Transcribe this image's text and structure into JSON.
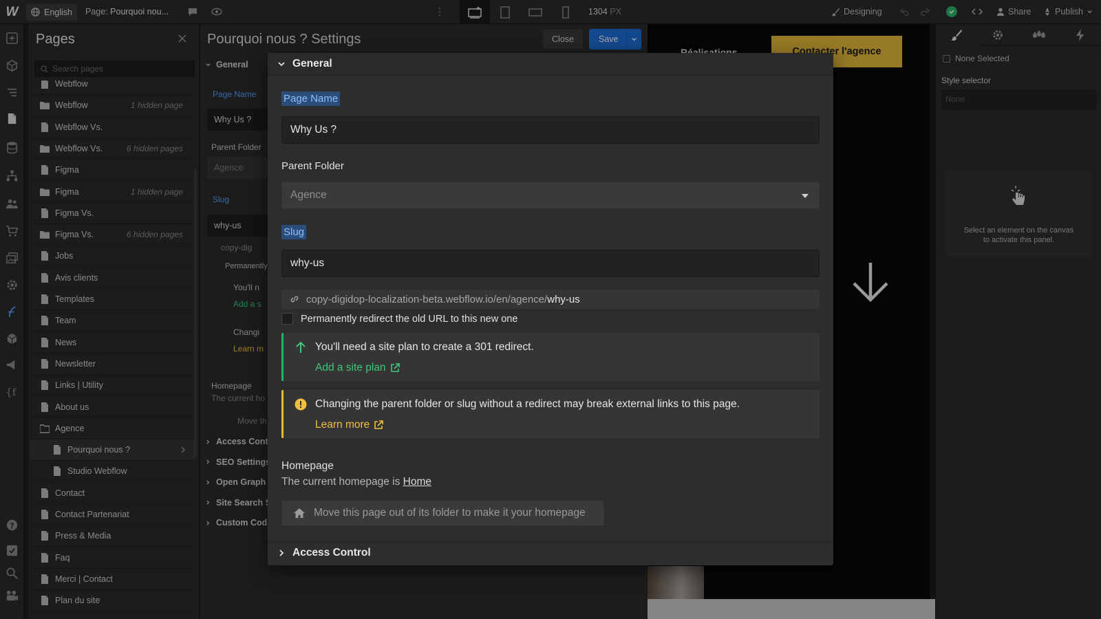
{
  "topbar": {
    "logo": "W",
    "locale": "English",
    "page_prefix": "Page:",
    "page_name": "Pourquoi nou...",
    "width_value": "1304",
    "width_unit": "PX",
    "mode": "Designing",
    "share": "Share",
    "publish": "Publish"
  },
  "pages_panel": {
    "title": "Pages",
    "search_placeholder": "Search pages",
    "items": [
      {
        "label": "Webflow",
        "type": "page",
        "hidden": ""
      },
      {
        "label": "Webflow",
        "type": "folder",
        "hidden": "1 hidden page"
      },
      {
        "label": "Webflow Vs.",
        "type": "page",
        "hidden": ""
      },
      {
        "label": "Webflow Vs.",
        "type": "folder",
        "hidden": "6 hidden pages"
      },
      {
        "label": "Figma",
        "type": "page",
        "hidden": ""
      },
      {
        "label": "Figma",
        "type": "folder",
        "hidden": "1 hidden page"
      },
      {
        "label": "Figma Vs.",
        "type": "page",
        "hidden": ""
      },
      {
        "label": "Figma Vs.",
        "type": "folder",
        "hidden": "6 hidden pages"
      },
      {
        "label": "Jobs",
        "type": "page",
        "hidden": ""
      },
      {
        "label": "Avis clients",
        "type": "page",
        "hidden": ""
      },
      {
        "label": "Templates",
        "type": "page",
        "hidden": ""
      },
      {
        "label": "Team",
        "type": "page",
        "hidden": ""
      },
      {
        "label": "News",
        "type": "page",
        "hidden": ""
      },
      {
        "label": "Newsletter",
        "type": "page",
        "hidden": ""
      },
      {
        "label": "Links | Utility",
        "type": "page",
        "hidden": ""
      },
      {
        "label": "About us",
        "type": "page",
        "hidden": ""
      },
      {
        "label": "Agence",
        "type": "folder-open",
        "hidden": ""
      },
      {
        "label": "Pourquoi nous ?",
        "type": "child-selected",
        "hidden": ""
      },
      {
        "label": "Studio Webflow",
        "type": "child",
        "hidden": ""
      },
      {
        "label": "Contact",
        "type": "page",
        "hidden": ""
      },
      {
        "label": "Contact Partenariat",
        "type": "page",
        "hidden": ""
      },
      {
        "label": "Press & Media",
        "type": "page",
        "hidden": ""
      },
      {
        "label": "Faq",
        "type": "page",
        "hidden": ""
      },
      {
        "label": "Merci | Contact",
        "type": "page",
        "hidden": ""
      },
      {
        "label": "Plan du site",
        "type": "page",
        "hidden": ""
      }
    ]
  },
  "settings": {
    "title": "Pourquoi nous ? Settings",
    "close_label": "Close",
    "save_label": "Save",
    "behind": {
      "general": "General",
      "page_name_label": "Page Name",
      "page_name_value": "Why Us ?",
      "parent_folder_label": "Parent Folder",
      "parent_folder_value": "Agence",
      "slug_label": "Slug",
      "slug_value": "why-us",
      "url_fragment": "copy-dig",
      "redirect_fragment": "Permanently",
      "green_fragment": "You'll n",
      "green_link_fragment": "Add a s",
      "yellow_fragment": "Changi",
      "yellow_link_fragment": "Learn m",
      "homepage_label": "Homepage",
      "homepage_fragment": "The current ho",
      "move_fragment": "Move th",
      "sections": [
        "Access Cont",
        "SEO Settings",
        "Open Graph",
        "Site Search S",
        "Custom Cod"
      ]
    }
  },
  "modal": {
    "general_header": "General",
    "page_name_label": "Page Name",
    "page_name_value": "Why Us ?",
    "parent_folder_label": "Parent Folder",
    "parent_folder_value": "Agence",
    "slug_label": "Slug",
    "slug_value": "why-us",
    "url_base": "copy-digidop-localization-beta.webflow.io/en/agence/",
    "url_slug": "why-us",
    "redirect_label": "Permanently redirect the old URL to this new one",
    "green_alert_text": "You'll need a site plan to create a 301 redirect.",
    "green_alert_link": "Add a site plan",
    "yellow_alert_text": "Changing the parent folder or slug without a redirect may break external links to this page.",
    "yellow_alert_link": "Learn more",
    "homepage_title": "Homepage",
    "homepage_text": "The current homepage is",
    "homepage_link": "Home",
    "homepage_button": "Move this page out of its folder to make it your homepage",
    "access_header": "Access Control"
  },
  "canvas": {
    "nav_item": "Réalisations",
    "cta_label": "Contacter l'agence"
  },
  "right_panel": {
    "none_selected": "None Selected",
    "style_selector_label": "Style selector",
    "style_selector_placeholder": "None",
    "empty_line1": "Select an element on the canvas",
    "empty_line2": "to activate this panel."
  },
  "colors": {
    "accent_blue": "#1f6ed8",
    "success_green": "#2bb36b",
    "warning_yellow": "#e6b93a",
    "cta_yellow": "#e6b93a"
  }
}
